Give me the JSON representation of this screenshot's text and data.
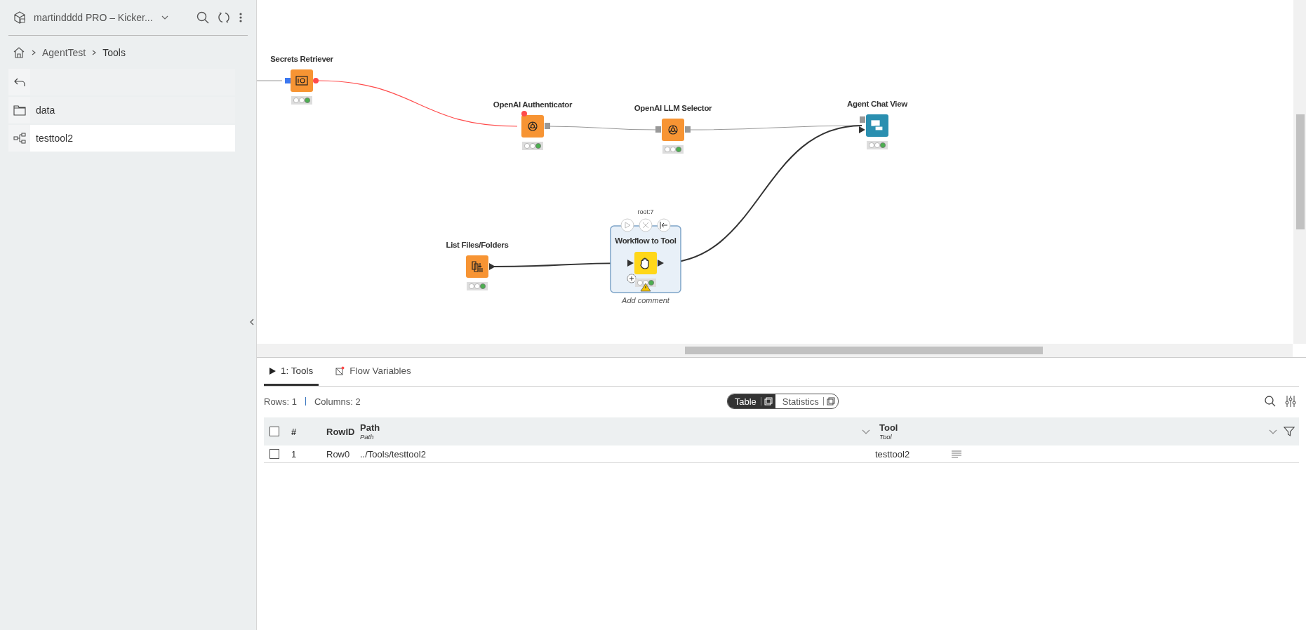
{
  "sidebar": {
    "space": "martindddd PRO – Kicker...",
    "breadcrumb": [
      "AgentTest",
      "Tools"
    ],
    "items": [
      {
        "kind": "back",
        "selected": false
      },
      {
        "kind": "folder",
        "label": "data",
        "selected": false
      },
      {
        "kind": "workflow",
        "label": "testtool2",
        "selected": true
      }
    ]
  },
  "canvas": {
    "nodes": [
      {
        "label": "Secrets Retriever",
        "kind": "secrets",
        "executed": true,
        "warning": false
      },
      {
        "label": "OpenAI Authenticator",
        "kind": "openai",
        "executed": true,
        "warning": false
      },
      {
        "label": "OpenAI LLM Selector",
        "kind": "openai",
        "executed": true,
        "warning": false
      },
      {
        "label": "Agent Chat View",
        "kind": "view",
        "executed": true,
        "warning": false
      },
      {
        "label": "List Files/Folders",
        "kind": "files",
        "executed": true,
        "warning": false
      },
      {
        "label": "Workflow to Tool",
        "kind": "component",
        "executed": true,
        "warning": true,
        "selected": true,
        "id": "root:7",
        "comment_placeholder": "Add comment"
      }
    ],
    "connections": [
      {
        "kind": "variable"
      },
      {
        "kind": "model"
      },
      {
        "kind": "model"
      },
      {
        "kind": "table"
      },
      {
        "kind": "table"
      }
    ]
  },
  "output": {
    "tabs": [
      {
        "label": "1: Tools",
        "kind": "port",
        "selected": true
      },
      {
        "label": "Flow Variables",
        "kind": "variables",
        "selected": false
      }
    ],
    "rows_info": "Rows: 1",
    "columns_info": "Columns: 2",
    "views": [
      {
        "label": "Table",
        "selected": true
      },
      {
        "label": "Statistics",
        "selected": false
      }
    ],
    "table": {
      "all_checked": false,
      "columns": [
        {
          "title": "#"
        },
        {
          "title": "RowID"
        },
        {
          "title": "Path",
          "type": "Path"
        },
        {
          "title": "Tool",
          "type": "Tool"
        }
      ],
      "rows": [
        {
          "checked": false,
          "cells": [
            "1",
            "Row0",
            "../Tools/testtool2",
            "testtool2"
          ]
        }
      ]
    }
  }
}
